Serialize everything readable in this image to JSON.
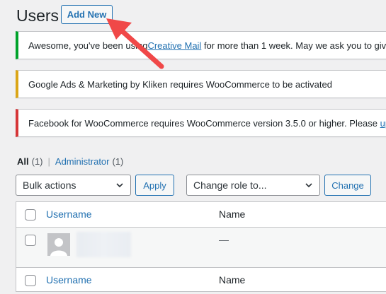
{
  "header": {
    "title": "Users",
    "add_new_label": "Add New"
  },
  "notices": {
    "success": {
      "before": "Awesome, you've been using ",
      "link": "Creative Mail",
      "after": " for more than 1 week. May we ask you to giv"
    },
    "warning": {
      "text": "Google Ads & Marketing by Kliken requires WooCommerce to be activated"
    },
    "error": {
      "before": "Facebook for WooCommerce requires WooCommerce version 3.5.0 or higher. Please ",
      "link": "upd"
    }
  },
  "filters": {
    "all_label": "All",
    "all_count": "(1)",
    "separator": "|",
    "administrator_label": "Administrator",
    "administrator_count": "(1)"
  },
  "bulk": {
    "bulk_actions_value": "Bulk actions",
    "apply_label": "Apply",
    "change_role_value": "Change role to...",
    "change_label": "Change"
  },
  "table": {
    "columns": {
      "username": "Username",
      "name": "Name"
    },
    "rows": [
      {
        "name": "—"
      }
    ]
  },
  "colors": {
    "accent": "#2271b1",
    "success": "#00a32a",
    "warning": "#dba617",
    "error": "#d63638",
    "annotation_arrow": "#f04848"
  },
  "icons": {
    "select_chevron": "chevron-down-icon",
    "avatar": "user-avatar-icon",
    "annotation": "pointer-arrow-icon"
  }
}
